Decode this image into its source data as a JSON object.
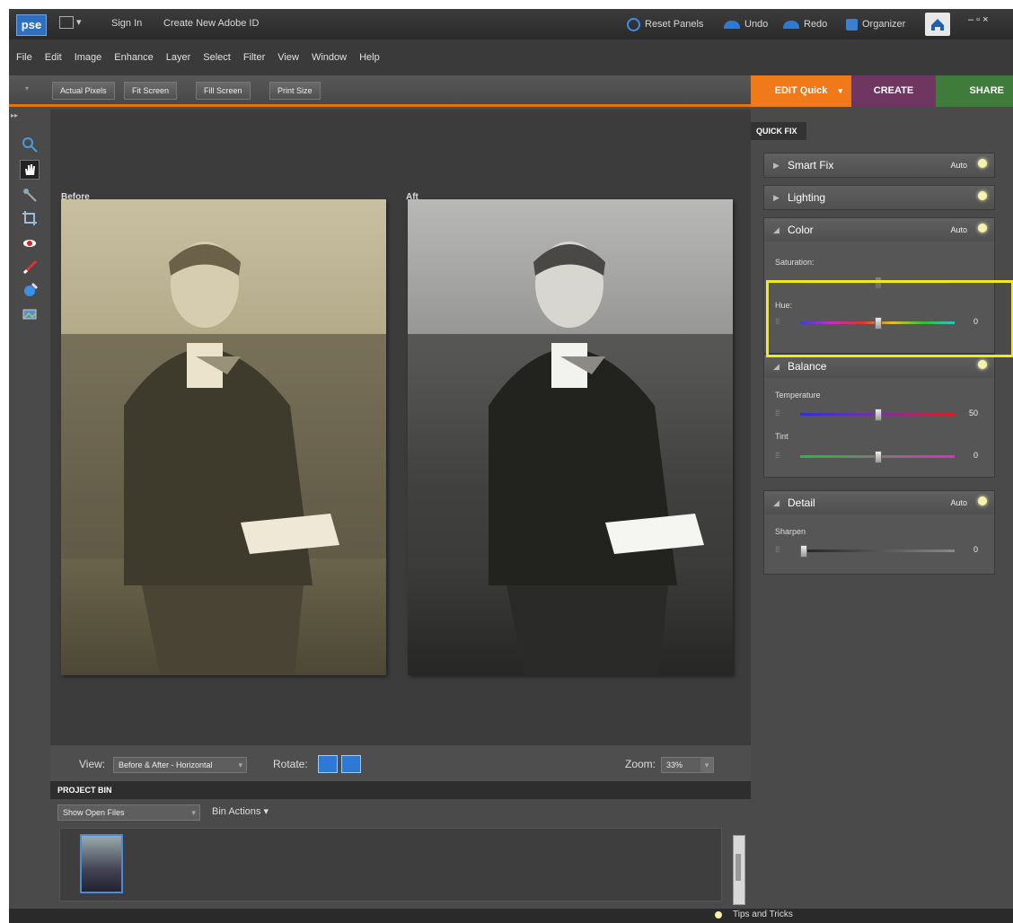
{
  "titlebar": {
    "logo": "pse",
    "links": [
      "Sign In",
      "Create New Adobe ID"
    ],
    "reset_panels": "Reset Panels",
    "undo": "Undo",
    "redo": "Redo",
    "organizer": "Organizer",
    "window_controls": "– ▫ ×"
  },
  "menu": [
    "File",
    "Edit",
    "Image",
    "Enhance",
    "Layer",
    "Select",
    "Filter",
    "View",
    "Window",
    "Help"
  ],
  "options": {
    "buttons": [
      "Actual Pixels",
      "Fit Screen",
      "Fill Screen",
      "Print Size"
    ]
  },
  "modes": {
    "edit": "EDIT Quick",
    "create": "CREATE",
    "share": "SHARE",
    "edit_color": "#f07a1a",
    "create_color": "#6e3660",
    "share_color": "#3f7b3a"
  },
  "canvas": {
    "before_label": "Before",
    "after_label": "After"
  },
  "viewbar": {
    "view_label": "View:",
    "view_value": "Before & After - Horizontal",
    "rotate_label": "Rotate:",
    "zoom_label": "Zoom:",
    "zoom_value": "33%"
  },
  "bin": {
    "title": "PROJECT BIN",
    "show_value": "Show Open Files",
    "actions": "Bin Actions"
  },
  "status": {
    "tips": "Tips and Tricks"
  },
  "panel": {
    "title": "QUICK FIX",
    "sections": {
      "smart_fix": {
        "title": "Smart Fix",
        "auto": "Auto"
      },
      "lighting": {
        "title": "Lighting"
      },
      "color": {
        "title": "Color",
        "auto": "Auto",
        "saturation_label": "Saturation:",
        "hue_label": "Hue:",
        "hue_value": "0"
      },
      "balance": {
        "title": "Balance",
        "temperature_label": "Temperature",
        "temperature_value": "50",
        "tint_label": "Tint",
        "tint_value": "0"
      },
      "detail": {
        "title": "Detail",
        "auto": "Auto",
        "sharpen_label": "Sharpen",
        "sharpen_value": "0"
      }
    }
  },
  "highlight_color": "#f0ea1d"
}
